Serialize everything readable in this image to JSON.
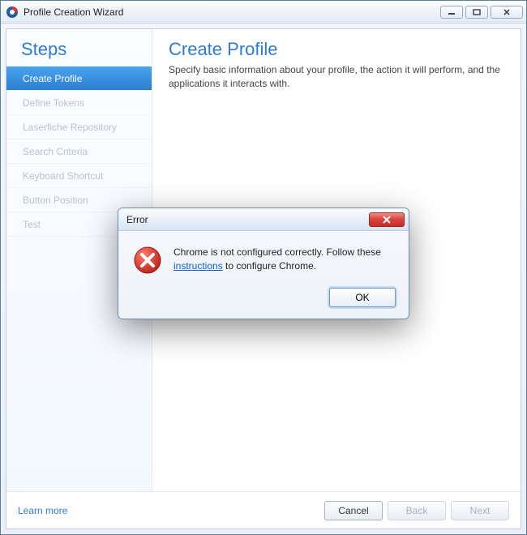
{
  "window": {
    "title": "Profile Creation Wizard"
  },
  "sidebar": {
    "header": "Steps",
    "items": [
      {
        "label": "Create Profile",
        "active": true
      },
      {
        "label": "Define Tokens"
      },
      {
        "label": "Laserfiche Repository"
      },
      {
        "label": "Search Criteria"
      },
      {
        "label": "Keyboard Shortcut"
      },
      {
        "label": "Button Position"
      },
      {
        "label": "Test"
      }
    ]
  },
  "main": {
    "title": "Create Profile",
    "description": "Specify basic information about your profile, the action it will perform, and the applications it interacts with."
  },
  "footer": {
    "learn_more": "Learn more",
    "cancel": "Cancel",
    "back": "Back",
    "next": "Next"
  },
  "error_dialog": {
    "title": "Error",
    "text_before": "Chrome is not configured correctly. Follow these ",
    "link": "instructions",
    "text_after": " to configure Chrome.",
    "ok": "OK"
  }
}
